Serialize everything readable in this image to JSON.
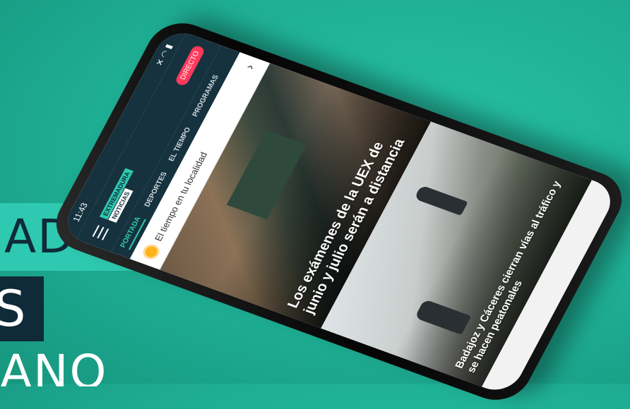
{
  "overlay": {
    "line1": "ADURA",
    "line2": "S",
    "line3": "ANO"
  },
  "phone": {
    "status_time": "11:43",
    "status_icons": "✕ ◠ ▮",
    "logo_top": "EXTREMADURA",
    "logo_bottom": "NOTICIAS",
    "live_label": "DIRECTO",
    "tabs": [
      "PORTADA",
      "DEPORTES",
      "EL TIEMPO",
      "PROGRAMAS"
    ],
    "weather_label": "El tiempo en tu localidad",
    "stories": [
      {
        "headline": "Los exámenes de la UEX de junio y julio serán a distancia"
      },
      {
        "headline": "Badajoz y Cáceres cierran vías al tráfico y se hacen peatonales"
      }
    ]
  },
  "colors": {
    "background": "#1eae94",
    "accent": "#2ec9b0",
    "dark_navy": "#16323f",
    "live_red": "#ff3b5c"
  },
  "icons": [
    "menu-icon",
    "sun-icon",
    "chevron-right-icon",
    "live-dot-icon"
  ]
}
